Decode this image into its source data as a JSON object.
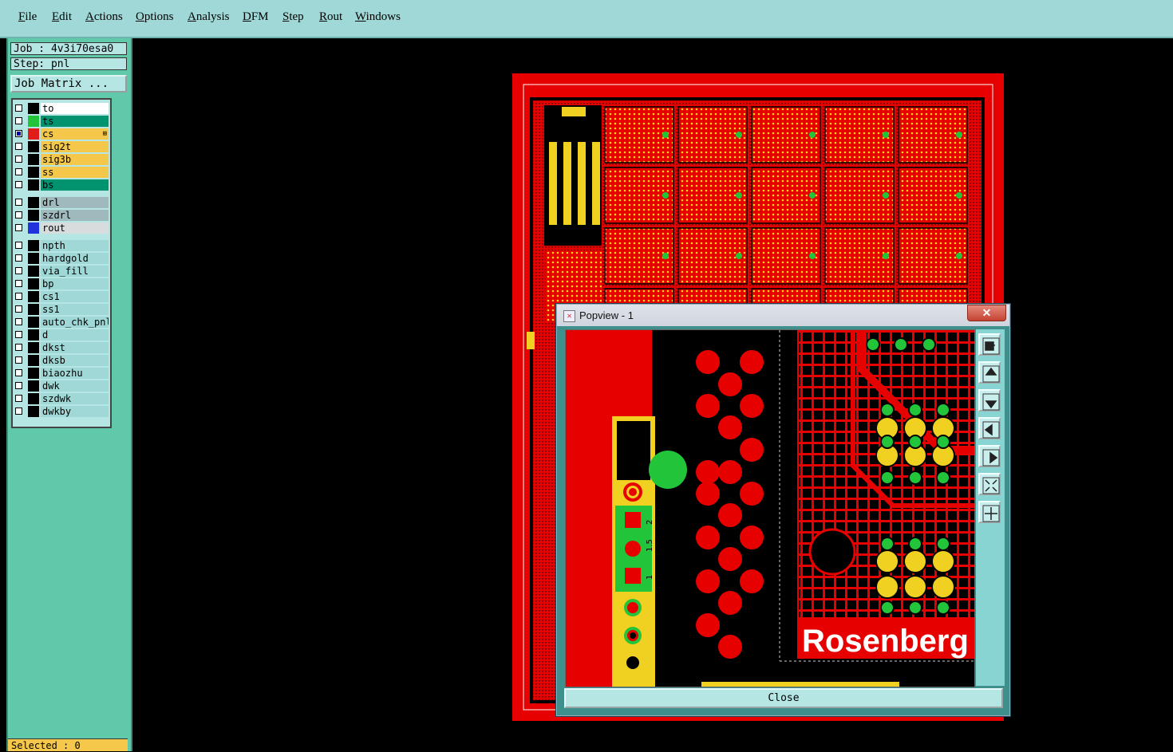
{
  "menu": {
    "items": [
      {
        "label": "File",
        "x": 0
      },
      {
        "label": "Edit"
      },
      {
        "label": "Actions"
      },
      {
        "label": "Options"
      },
      {
        "label": "Analysis"
      },
      {
        "label": "DFM"
      },
      {
        "label": "Step"
      },
      {
        "label": "Rout"
      },
      {
        "label": "Windows"
      }
    ]
  },
  "job": {
    "job_line": "Job : 4v3i70esa0",
    "step_line": "Step: pnl",
    "matrix_button": "Job Matrix ..."
  },
  "layers": [
    {
      "name": "to",
      "color": "#ffffff",
      "swatch": "#000000",
      "checked": false
    },
    {
      "name": "ts",
      "color": "#00936f",
      "swatch": "#22c43a",
      "checked": false
    },
    {
      "name": "cs",
      "color": "#f5c84b",
      "swatch": "#e21b1b",
      "checked": true,
      "marker": "⊞"
    },
    {
      "name": "sig2t",
      "color": "#f5c84b",
      "swatch": "#000000",
      "checked": false
    },
    {
      "name": "sig3b",
      "color": "#f5c84b",
      "swatch": "#000000",
      "checked": false
    },
    {
      "name": "ss",
      "color": "#f5c84b",
      "swatch": "#000000",
      "checked": false
    },
    {
      "name": "bs",
      "color": "#00936f",
      "swatch": "#000000",
      "checked": false
    },
    {
      "name": "drl",
      "color": "#9fb9bd",
      "swatch": "#000000",
      "checked": false
    },
    {
      "name": "szdrl",
      "color": "#9fb9bd",
      "swatch": "#000000",
      "checked": false
    },
    {
      "name": "rout",
      "color": "#d8dcdc",
      "swatch": "#2233dd",
      "checked": false
    },
    {
      "name": "npth",
      "color": "#9fd8d6",
      "swatch": "#000000",
      "checked": false
    },
    {
      "name": "hardgold",
      "color": "#9fd8d6",
      "swatch": "#000000",
      "checked": false
    },
    {
      "name": "via_fill",
      "color": "#9fd8d6",
      "swatch": "#000000",
      "checked": false
    },
    {
      "name": "bp",
      "color": "#9fd8d6",
      "swatch": "#000000",
      "checked": false
    },
    {
      "name": "cs1",
      "color": "#9fd8d6",
      "swatch": "#000000",
      "checked": false
    },
    {
      "name": "ss1",
      "color": "#9fd8d6",
      "swatch": "#000000",
      "checked": false
    },
    {
      "name": "auto_chk_pnl",
      "color": "#9fd8d6",
      "swatch": "#000000",
      "checked": false
    },
    {
      "name": "d",
      "color": "#9fd8d6",
      "swatch": "#000000",
      "checked": false
    },
    {
      "name": "dkst",
      "color": "#9fd8d6",
      "swatch": "#000000",
      "checked": false
    },
    {
      "name": "dksb",
      "color": "#9fd8d6",
      "swatch": "#000000",
      "checked": false
    },
    {
      "name": "biaozhu",
      "color": "#9fd8d6",
      "swatch": "#000000",
      "checked": false
    },
    {
      "name": "dwk",
      "color": "#9fd8d6",
      "swatch": "#000000",
      "checked": false
    },
    {
      "name": "szdwk",
      "color": "#9fd8d6",
      "swatch": "#000000",
      "checked": false
    },
    {
      "name": "dwkby",
      "color": "#9fd8d6",
      "swatch": "#000000",
      "checked": false
    }
  ],
  "status": {
    "selected": "Selected : 0"
  },
  "popview": {
    "title": "Popview - 1",
    "close_label": "Close",
    "window_close": "✕",
    "silk_text": "Rosenberg",
    "pin_labels": [
      "2",
      "1.5",
      "1"
    ]
  },
  "colors": {
    "copper": "#e60000",
    "mask": "#22c43a",
    "gold": "#f0d020",
    "panel": "#9fd8d6"
  },
  "icons": [
    "zoom-window-icon",
    "pan-up-icon",
    "pan-down-icon",
    "pan-left-icon",
    "pan-right-icon",
    "zoom-in-icon",
    "zoom-out-icon"
  ]
}
